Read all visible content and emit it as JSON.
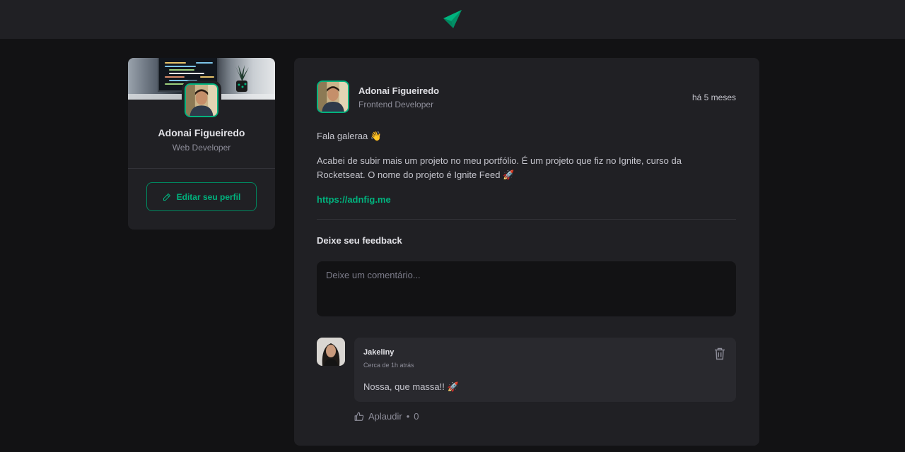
{
  "header": {
    "logo_icon": "ignite-feed-logo-icon"
  },
  "profile": {
    "name": "Adonai Figueiredo",
    "role": "Web Developer",
    "edit_label": "Editar seu perfil",
    "edit_icon": "pencil-icon"
  },
  "post": {
    "author_name": "Adonai Figueiredo",
    "author_role": "Frontend Developer",
    "time": "há 5 meses",
    "greeting": "Fala galeraa 👋",
    "body": "Acabei de subir mais um projeto no meu portfólio. É um projeto que fiz no Ignite, curso da Rocketseat. O nome do projeto é Ignite Feed 🚀",
    "link": "https://adnfig.me",
    "feedback_title": "Deixe seu feedback",
    "comment_placeholder": "Deixe um comentário..."
  },
  "comments": [
    {
      "author": "Jakeliny",
      "time": "Cerca de 1h atrás",
      "text": "Nossa, que massa!! 🚀",
      "delete_icon": "trash-icon",
      "applaud_label": "Aplaudir",
      "applaud_separator": "•",
      "applaud_count": "0",
      "applaud_icon": "thumbs-up-icon"
    }
  ],
  "colors": {
    "brand": "#00b37e",
    "background": "#121214",
    "surface": "#202024",
    "comment_surface": "#29292e"
  }
}
